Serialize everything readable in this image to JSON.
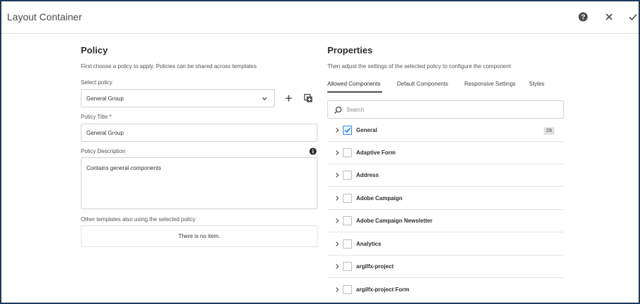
{
  "dialog": {
    "title": "Layout Container",
    "help_icon": "help-circle-icon",
    "close_icon": "close-icon",
    "confirm_icon": "checkmark-icon"
  },
  "policy": {
    "heading": "Policy",
    "description": "First choose a policy to apply. Policies can be shared across templates",
    "select_label": "Select policy",
    "select_value": "General Group",
    "add_icon": "plus-icon",
    "duplicate_icon": "duplicate-icon",
    "title_label": "Policy Title *",
    "title_value": "General Group",
    "description_label": "Policy Description",
    "description_value": "Contains general components",
    "info_icon": "info-icon",
    "other_templates_label": "Other templates also using the selected policy",
    "other_templates_empty": "There is no item."
  },
  "properties": {
    "heading": "Properties",
    "description": "Then adjust the settings of the selected policy to configure the component",
    "tabs": [
      {
        "label": "Allowed Components",
        "active": true
      },
      {
        "label": "Default Components",
        "active": false
      },
      {
        "label": "Responsive Settings",
        "active": false
      },
      {
        "label": "Styles",
        "active": false
      }
    ],
    "search_placeholder": "Search",
    "components": [
      {
        "label": "General",
        "checked": true,
        "count": "29"
      },
      {
        "label": "Adaptive Form",
        "checked": false
      },
      {
        "label": "Address",
        "checked": false
      },
      {
        "label": "Adobe Campaign",
        "checked": false
      },
      {
        "label": "Adobe Campaign Newsletter",
        "checked": false
      },
      {
        "label": "Analytics",
        "checked": false
      },
      {
        "label": "argilfx-project",
        "checked": false
      },
      {
        "label": "argilfx-project Form",
        "checked": false
      }
    ]
  },
  "colors": {
    "accent": "#2680eb",
    "frame_border": "#1f3a5a"
  }
}
